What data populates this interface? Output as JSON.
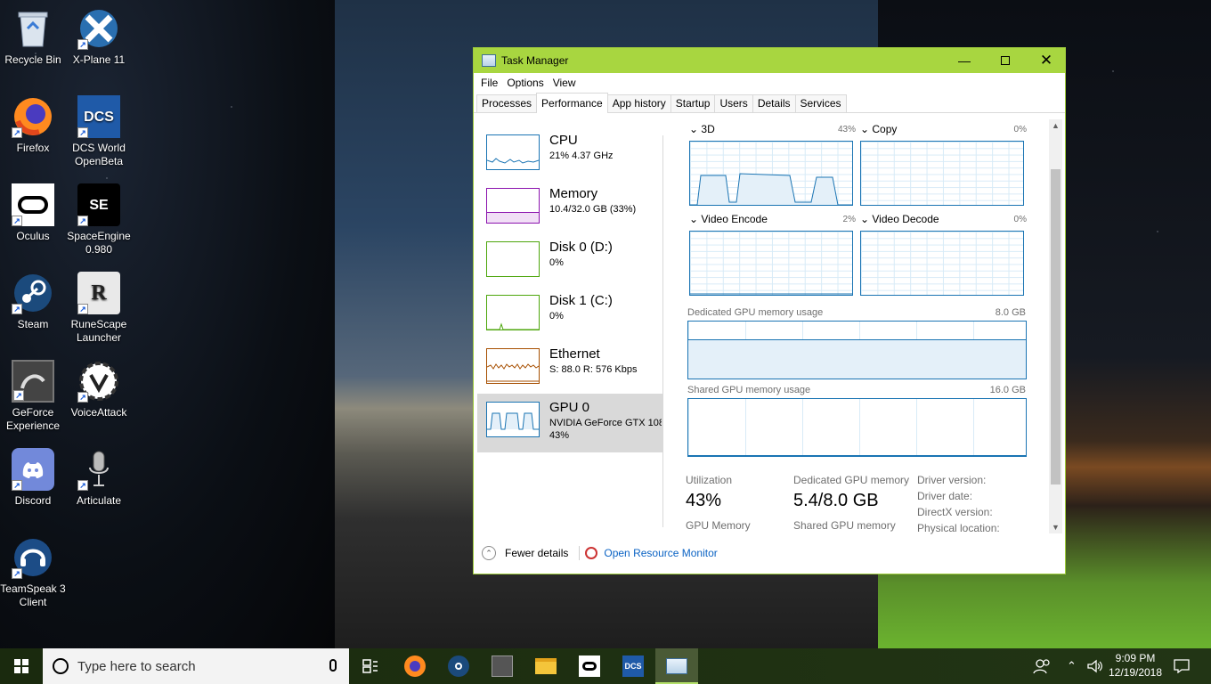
{
  "desktop": {
    "icons": [
      {
        "label": "Recycle Bin",
        "icon": "recycle-bin-icon"
      },
      {
        "label": "X-Plane 11",
        "icon": "xplane-icon"
      },
      {
        "label": "Firefox",
        "icon": "firefox-icon"
      },
      {
        "label": "DCS World OpenBeta",
        "icon": "dcs-icon"
      },
      {
        "label": "Oculus",
        "icon": "oculus-icon"
      },
      {
        "label": "SpaceEngine 0.980",
        "icon": "spaceengine-icon"
      },
      {
        "label": "Steam",
        "icon": "steam-icon"
      },
      {
        "label": "RuneScape Launcher",
        "icon": "runescape-icon"
      },
      {
        "label": "GeForce Experience",
        "icon": "geforce-icon"
      },
      {
        "label": "VoiceAttack",
        "icon": "voiceattack-icon"
      },
      {
        "label": "Discord",
        "icon": "discord-icon"
      },
      {
        "label": "Articulate",
        "icon": "articulate-icon"
      },
      {
        "label": "TeamSpeak 3 Client",
        "icon": "teamspeak-icon"
      }
    ]
  },
  "task_manager": {
    "title": "Task Manager",
    "menu": [
      "File",
      "Options",
      "View"
    ],
    "tabs": [
      "Processes",
      "Performance",
      "App history",
      "Startup",
      "Users",
      "Details",
      "Services"
    ],
    "active_tab": "Performance",
    "resources": [
      {
        "name": "CPU",
        "sub": "21% 4.37 GHz",
        "sub2": "",
        "color": "#1a74b3"
      },
      {
        "name": "Memory",
        "sub": "10.4/32.0 GB (33%)",
        "sub2": "",
        "color": "#8b12ae"
      },
      {
        "name": "Disk 0 (D:)",
        "sub": "0%",
        "sub2": "",
        "color": "#4da60c"
      },
      {
        "name": "Disk 1 (C:)",
        "sub": "0%",
        "sub2": "",
        "color": "#4da60c"
      },
      {
        "name": "Ethernet",
        "sub": "S: 88.0  R: 576 Kbps",
        "sub2": "",
        "color": "#a74f01"
      },
      {
        "name": "GPU 0",
        "sub": "NVIDIA GeForce GTX 108",
        "sub2": "43%",
        "color": "#1a74b3",
        "selected": true
      }
    ],
    "engines": [
      {
        "name": "3D",
        "pct": "43%"
      },
      {
        "name": "Copy",
        "pct": "0%"
      },
      {
        "name": "Video Encode",
        "pct": "2%"
      },
      {
        "name": "Video Decode",
        "pct": "0%"
      }
    ],
    "dedicated_mem": {
      "label": "Dedicated GPU memory usage",
      "max": "8.0 GB"
    },
    "shared_mem": {
      "label": "Shared GPU memory usage",
      "max": "16.0 GB"
    },
    "stats": {
      "utilization_label": "Utilization",
      "utilization_value": "43%",
      "dedicated_label": "Dedicated GPU memory",
      "dedicated_value": "5.4/8.0 GB",
      "gpu_memory_label": "GPU Memory",
      "shared_label": "Shared GPU memory",
      "driver_version": "Driver version:",
      "driver_date": "Driver date:",
      "directx_version": "DirectX version:",
      "physical_location": "Physical location:"
    },
    "footer": {
      "fewer_details": "Fewer details",
      "open_resource_monitor": "Open Resource Monitor"
    }
  },
  "taskbar": {
    "search_placeholder": "Type here to search",
    "pinned": [
      "task-view-icon",
      "firefox-icon",
      "steam-icon",
      "geforce-icon",
      "file-explorer-icon",
      "oculus-icon",
      "dcs-icon",
      "task-manager-icon"
    ],
    "clock_time": "9:09 PM",
    "clock_date": "12/19/2018"
  }
}
